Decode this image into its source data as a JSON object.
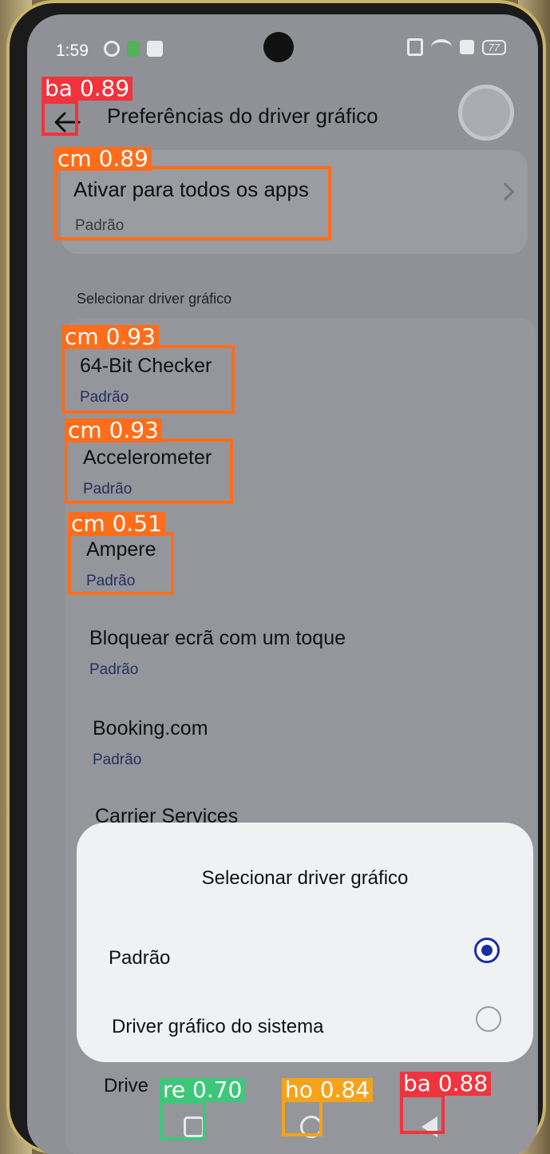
{
  "status_bar": {
    "time": "1:59",
    "battery": "77"
  },
  "header": {
    "title": "Preferências do driver gráfico",
    "back_icon": "arrow-left-icon"
  },
  "enable_all": {
    "title": "Ativar para todos os apps",
    "value": "Padrão"
  },
  "section_label": "Selecionar driver gráfico",
  "apps": [
    {
      "name": "64-Bit Checker",
      "value": "Padrão"
    },
    {
      "name": "Accelerometer",
      "value": "Padrão"
    },
    {
      "name": "Ampere",
      "value": "Padrão"
    },
    {
      "name": "Bloquear ecrã com um toque",
      "value": "Padrão"
    },
    {
      "name": "Booking.com",
      "value": "Padrão"
    },
    {
      "name": "Carrier Services",
      "value": ""
    }
  ],
  "partial_item": "Drive",
  "dialog": {
    "title": "Selecionar driver gráfico",
    "options": [
      {
        "label": "Padrão",
        "selected": true
      },
      {
        "label": "Driver gráfico do sistema",
        "selected": false
      }
    ]
  },
  "nav_bar": {
    "recent_icon": "square-icon",
    "home_icon": "circle-icon",
    "back_icon": "triangle-back-icon"
  },
  "detections": [
    {
      "label": "ba 0.89",
      "color": "#f0333c"
    },
    {
      "label": "cm 0.89",
      "color": "#ff6d1a"
    },
    {
      "label": "cm 0.93",
      "color": "#ff6d1a"
    },
    {
      "label": "cm 0.93",
      "color": "#ff6d1a"
    },
    {
      "label": "cm 0.51",
      "color": "#ff6d1a"
    },
    {
      "label": "re 0.70",
      "color": "#3ec77a"
    },
    {
      "label": "ho 0.84",
      "color": "#f5a31a"
    },
    {
      "label": "ba 0.88",
      "color": "#f0333c"
    }
  ]
}
